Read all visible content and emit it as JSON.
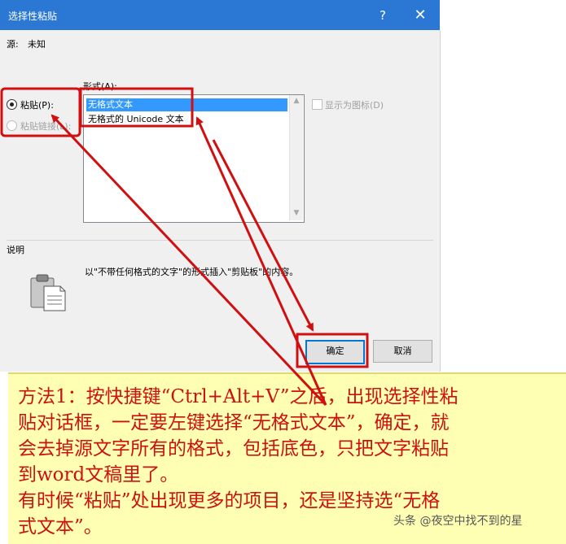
{
  "window": {
    "title": "选择性粘贴",
    "help_glyph": "?",
    "close_glyph": "✕"
  },
  "source": {
    "label": "源:",
    "value": "未知"
  },
  "format": {
    "label": "形式(A):",
    "items": [
      "无格式文本",
      "无格式的 Unicode 文本"
    ]
  },
  "options": {
    "paste": "粘贴(P):",
    "paste_link": "粘贴链接(L):",
    "show_icon": "显示为图标(D)"
  },
  "description": {
    "label": "说明",
    "text": "以\"不带任何格式的文字\"的形式插入\"剪贴板\"的内容。"
  },
  "buttons": {
    "ok": "确定",
    "cancel": "取消"
  },
  "annotation": {
    "lines": [
      "方法1：按快捷键“Ctrl+Alt+V”之后，出现选择性粘",
      "贴对话框，一定要左键选择“无格式文本”，确定，就",
      "会去掉源文字所有的格式，包括底色，只把文字粘贴",
      "到word文稿里了。",
      "有时候“粘贴”处出现更多的项目，还是坚持选“无格",
      "式文本”。"
    ],
    "watermark": "头条 @夜空中找不到的星"
  },
  "colors": {
    "titlebar": "#2b78d4",
    "selection": "#3399ff",
    "annotation_red": "#cc1111",
    "annotation_bg": "#ffffb4"
  }
}
